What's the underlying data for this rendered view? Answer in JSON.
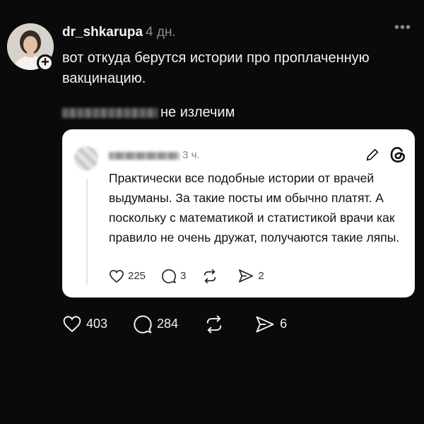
{
  "post": {
    "username": "dr_shkarupa",
    "time": "4 дн.",
    "text": "вот откуда берутся истории про проплаченную вакцинацию.",
    "reply_suffix": "не излечим",
    "likes": "403",
    "comments": "284",
    "shares": "6"
  },
  "quote": {
    "time": "3 ч.",
    "text": "Практически все подобные истории от врачей выдуманы. За такие посты им обычно платят. А поскольку с математикой и статистикой врачи как правило не очень дружат, получаются такие ляпы.",
    "likes": "225",
    "comments": "3",
    "shares": "2"
  },
  "icons": {
    "more": "more-icon",
    "like": "heart-icon",
    "comment": "comment-icon",
    "repost": "repost-icon",
    "share": "send-icon",
    "edit": "pencil-icon",
    "brand": "threads-icon"
  },
  "colors": {
    "background": "#0a0a0a",
    "text": "#f2f2f2",
    "muted": "#8a8a8a",
    "card": "#ffffff"
  }
}
